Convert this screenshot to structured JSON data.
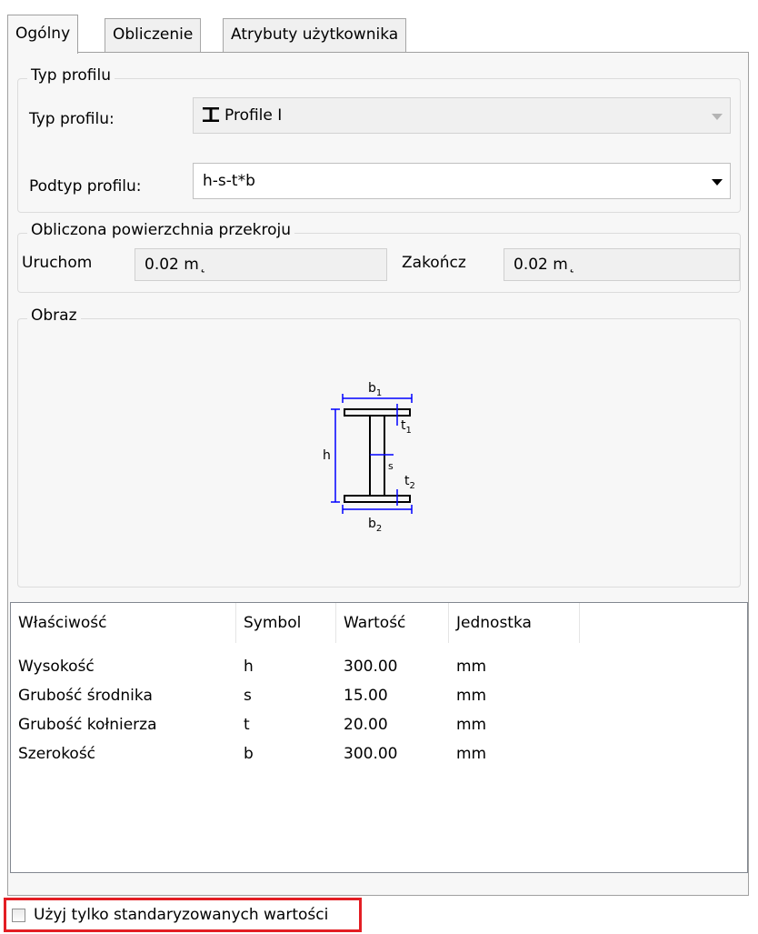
{
  "tabs": [
    "Ogólny",
    "Obliczenie",
    "Atrybuty użytkownika"
  ],
  "profile_type_group": {
    "title": "Typ profilu",
    "type_label": "Typ profilu:",
    "type_value": "Profile I",
    "type_icon": "i-beam-icon",
    "subtype_label": "Podtyp profilu:",
    "subtype_value": "h-s-t*b"
  },
  "area_group": {
    "title": "Obliczona powierzchnia przekroju",
    "start_label": "Uruchom",
    "start_value": "0.02 m˛",
    "end_label": "Zakończ",
    "end_value": "0.02 m˛"
  },
  "image_group": {
    "title": "Obraz",
    "dimension_labels": {
      "b1": "b",
      "b1_sub": "1",
      "b2": "b",
      "b2_sub": "2",
      "h": "h",
      "s": "s",
      "t1": "t",
      "t1_sub": "1",
      "t2": "t",
      "t2_sub": "2"
    }
  },
  "properties_table": {
    "columns": [
      "Właściwość",
      "Symbol",
      "Wartość",
      "Jednostka"
    ],
    "rows": [
      [
        "Wysokość",
        "h",
        "300.00",
        "mm"
      ],
      [
        "Grubość środnika",
        "s",
        "15.00",
        "mm"
      ],
      [
        "Grubość kołnierza",
        "t",
        "20.00",
        "mm"
      ],
      [
        "Szerokość",
        "b",
        "300.00",
        "mm"
      ]
    ]
  },
  "standardized_checkbox": {
    "label": "Użyj tylko standaryzowanych wartości",
    "checked": false
  },
  "colors": {
    "dimension_lines": "#0000ff",
    "highlight": "#e31e24"
  }
}
